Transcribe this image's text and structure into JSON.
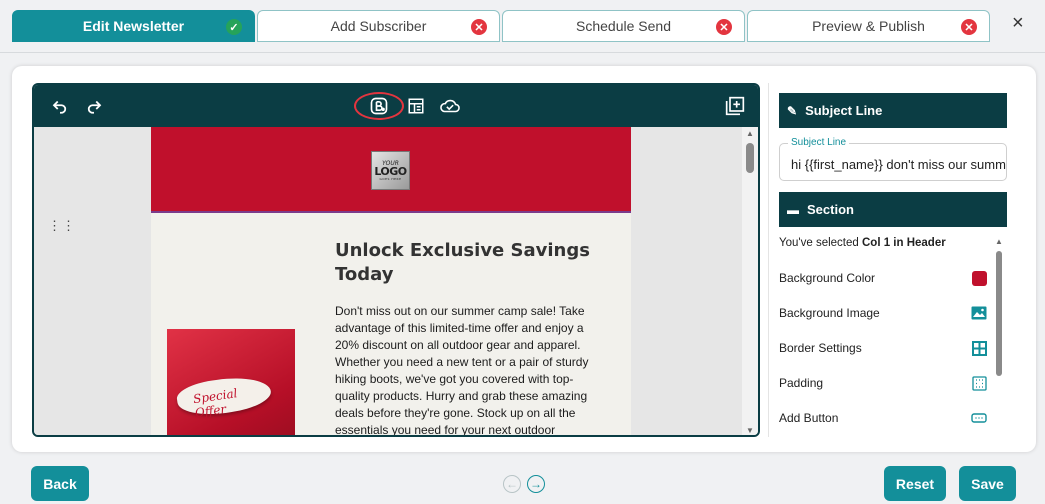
{
  "tabs": [
    {
      "label": "Edit Newsletter",
      "status": "done"
    },
    {
      "label": "Add Subscriber",
      "status": "error"
    },
    {
      "label": "Schedule Send",
      "status": "error"
    },
    {
      "label": "Preview & Publish",
      "status": "error"
    }
  ],
  "close_symbol": "×",
  "toolbar": {
    "icons": [
      "undo-icon",
      "redo-icon",
      "brand-icon",
      "template-icon",
      "cloud-icon",
      "add-block-icon"
    ]
  },
  "email": {
    "logo": {
      "line1": "YOUR",
      "line2": "LOGO",
      "line3": "GOES HERE"
    },
    "promo_text": "Special Offer",
    "title": "Unlock Exclusive Savings Today",
    "body": "Don't miss out on our summer camp sale! Take advantage of this limited-time offer and enjoy a 20% discount on all outdoor gear and apparel. Whether you need a new tent or a pair of sturdy hiking boots, we've got you covered with top-quality products. Hurry and grab these amazing deals before they're gone. Stock up on all the essentials you need for your next outdoor"
  },
  "panel": {
    "subject_header": "Subject Line",
    "subject_field_label": "Subject Line",
    "subject_value": "hi {{first_name}} don't miss our summer sale",
    "section_header": "Section",
    "selected_prefix": "You've selected ",
    "selected_target": "Col 1 in Header",
    "properties": [
      {
        "label": "Background Color",
        "icon": "color-swatch-icon"
      },
      {
        "label": "Background Image",
        "icon": "image-icon"
      },
      {
        "label": "Border Settings",
        "icon": "border-grid-icon"
      },
      {
        "label": "Padding",
        "icon": "padding-icon"
      },
      {
        "label": "Add Button",
        "icon": "button-icon"
      }
    ],
    "swatch_color": "#c0102c"
  },
  "footer": {
    "back_label": "Back",
    "reset_label": "Reset",
    "save_label": "Save"
  },
  "colors": {
    "accent": "#138f9a",
    "toolbar": "#0b3d44",
    "header_red": "#c0102c",
    "done_green": "#25a35a",
    "error_red": "#e3353f"
  }
}
